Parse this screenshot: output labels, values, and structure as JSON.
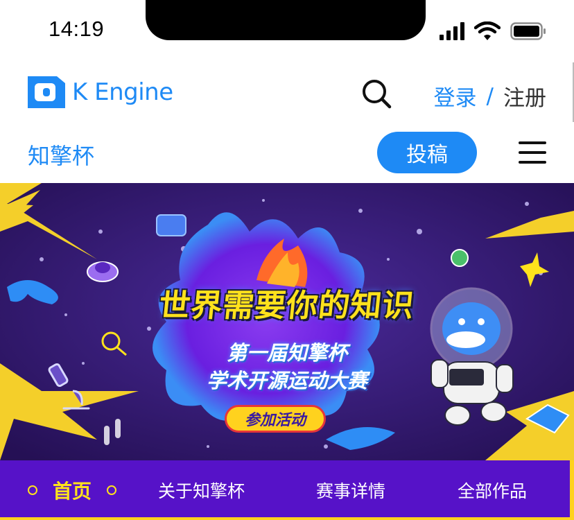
{
  "status_bar": {
    "time": "14:19",
    "icons": [
      "signal-icon",
      "wifi-icon",
      "battery-icon"
    ]
  },
  "header": {
    "brand": "K Engine",
    "search_icon": "search-icon",
    "login": "登录",
    "separator": "/",
    "register": "注册"
  },
  "sub_header": {
    "title": "知擎杯",
    "submit_label": "投稿",
    "menu_icon": "hamburger-menu-icon"
  },
  "banner": {
    "headline": "世界需要你的知识",
    "subtitle_line1": "第一届知擎杯",
    "subtitle_line2": "学术开源运动大赛",
    "cta": "参加活动"
  },
  "nav": {
    "items": [
      {
        "label": "首页",
        "active": true
      },
      {
        "label": "关于知擎杯",
        "active": false
      },
      {
        "label": "赛事详情",
        "active": false
      },
      {
        "label": "全部作品",
        "active": false
      }
    ]
  },
  "colors": {
    "brand_blue": "#1e8af5",
    "nav_purple": "#5612c8",
    "accent_yellow": "#ffe21c"
  }
}
